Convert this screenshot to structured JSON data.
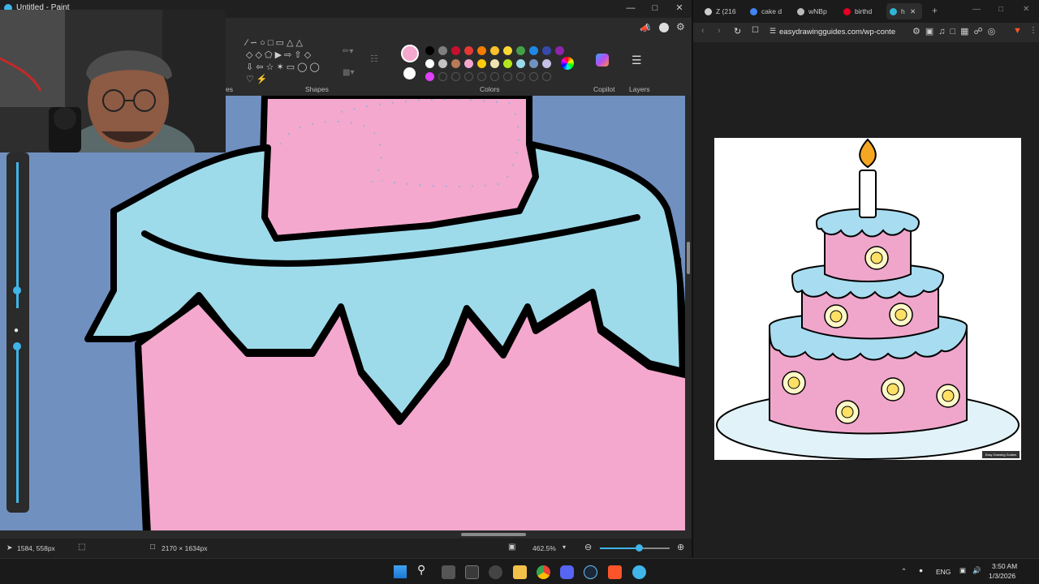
{
  "paint": {
    "title": "Untitled - Paint",
    "ribbon": {
      "shapes_label": "Shapes",
      "colors_label": "Colors",
      "copilot_label": "Copilot",
      "layers_label": "Layers",
      "partial_label": "es"
    },
    "palette": {
      "selected": "#f4a8cd",
      "row1": [
        "#000000",
        "#7f7f7f",
        "#c8102e",
        "#e53935",
        "#f57c00",
        "#fbc02d",
        "#fdd835",
        "#43a047",
        "#1e88e5",
        "#3949ab",
        "#8e24aa"
      ],
      "row2": [
        "#ffffff",
        "#c3c3c3",
        "#b97a57",
        "#f4a8cd",
        "#ffc90e",
        "#efe4b0",
        "#b5e61d",
        "#99d9ea",
        "#7092be",
        "#c8bfe7"
      ],
      "row3_first": "#e040fb"
    },
    "status": {
      "cursor_pos": "1584, 558px",
      "canvas_size": "2170 × 1634px",
      "zoom": "462.5%"
    }
  },
  "browser": {
    "tabs": [
      {
        "label": "Z (216",
        "icon": "z-favicon",
        "color": "#cccccc"
      },
      {
        "label": "cake d",
        "icon": "google-favicon",
        "color": "#4285f4"
      },
      {
        "label": "wNBp",
        "icon": "globe-favicon",
        "color": "#bbbbbb"
      },
      {
        "label": "birthd",
        "icon": "pinterest-favicon",
        "color": "#e60023"
      },
      {
        "label": "h",
        "icon": "site-favicon",
        "color": "#2fb7d6"
      }
    ],
    "url": "easydrawingguides.com/wp-conte",
    "watermark": "Easy Drawing Guides"
  },
  "taskbar": {
    "language": "ENG",
    "time": "3:50 AM",
    "date": "1/3/2026"
  },
  "colors": {
    "canvas_bg": "#7090c0",
    "cake_pink": "#f4a8cd",
    "frosting_blue": "#9edbea",
    "outline": "#000000"
  }
}
